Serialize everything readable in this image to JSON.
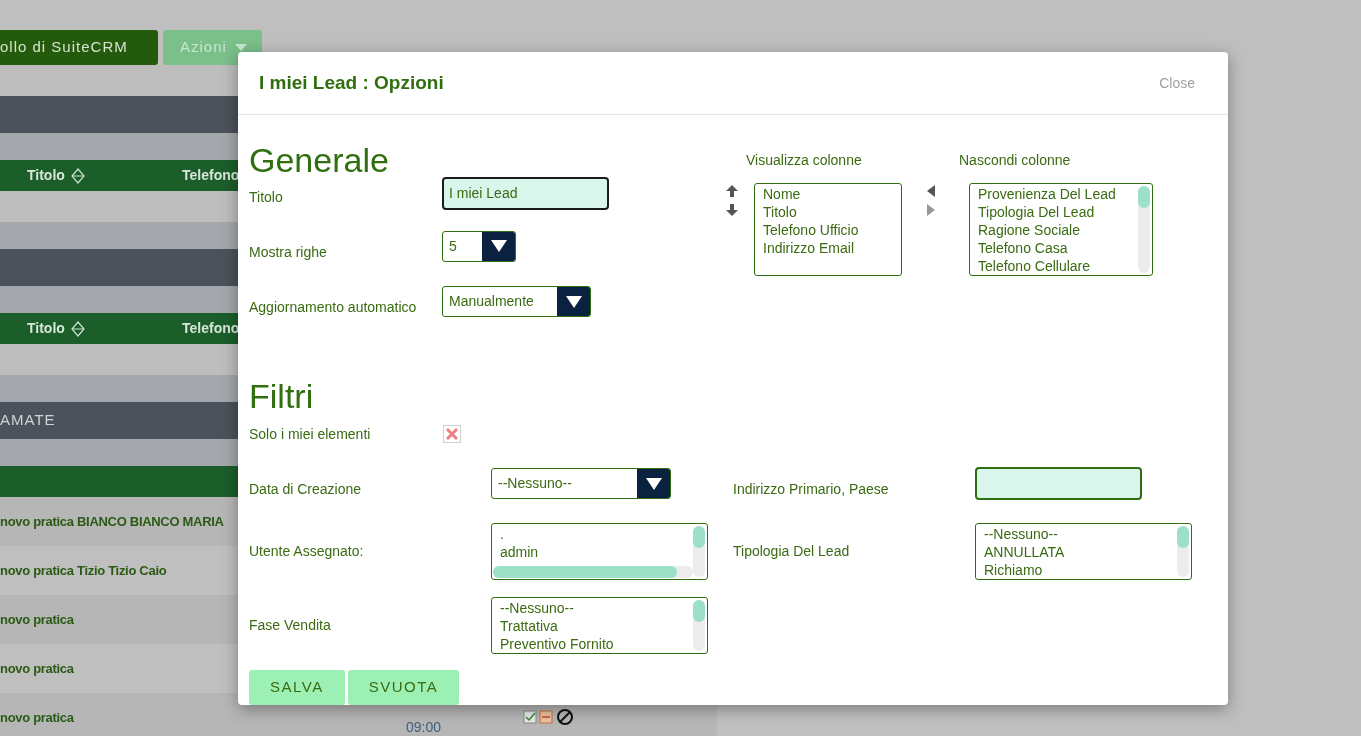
{
  "background": {
    "module_button": "ollo di SuiteCRM",
    "actions_button": "Azioni",
    "rows": [
      {
        "kind": "blank"
      },
      {
        "kind": "band",
        "text": ""
      },
      {
        "kind": "sub"
      },
      {
        "kind": "header",
        "columns": [
          "Titolo",
          "Telefono"
        ]
      },
      {
        "kind": "blank"
      },
      {
        "kind": "sub"
      },
      {
        "kind": "band",
        "text": ""
      },
      {
        "kind": "sub"
      },
      {
        "kind": "header",
        "columns": [
          "Titolo",
          "Telefono"
        ]
      },
      {
        "kind": "blank"
      },
      {
        "kind": "sub"
      },
      {
        "kind": "band",
        "text": "AMATE"
      },
      {
        "kind": "sub"
      },
      {
        "kind": "header",
        "columns": []
      },
      {
        "kind": "row",
        "text": "novo pratica BIANCO BIANCO MARIA"
      },
      {
        "kind": "row",
        "text": "novo pratica Tizio Tizio Caio"
      },
      {
        "kind": "row",
        "text": "novo pratica"
      },
      {
        "kind": "row",
        "text": "novo pratica"
      },
      {
        "kind": "row",
        "text": "novo pratica",
        "time": "09:00"
      }
    ]
  },
  "dialog": {
    "title": "I miei Lead : Opzioni",
    "close": "Close"
  },
  "general": {
    "heading": "Generale",
    "fields": [
      {
        "kind": "text",
        "label": "Titolo",
        "value": "I miei Lead",
        "focused": true
      },
      {
        "kind": "select",
        "label": "Mostra righe",
        "value": "5"
      },
      {
        "kind": "select",
        "label": "Aggiornamento automatico",
        "value": "Manualmente"
      }
    ]
  },
  "columns": {
    "shown": {
      "label": "Visualizza colonne",
      "items": [
        "Nome",
        "Titolo",
        "Telefono Ufficio",
        "Indirizzo Email"
      ]
    },
    "hidden": {
      "label": "Nascondi colonne",
      "items": [
        "Provenienza Del Lead",
        "Tipologia Del Lead",
        "Ragione Sociale",
        "Telefono Casa",
        "Telefono Cellulare"
      ]
    }
  },
  "filters": {
    "heading": "Filtri",
    "rows": [
      [
        {
          "kind": "checkbox",
          "label": "Solo i miei elementi",
          "checked": true
        }
      ],
      [
        {
          "kind": "select",
          "label": "Data di Creazione",
          "value": "--Nessuno--"
        },
        {
          "kind": "text",
          "label": "Indirizzo Primario, Paese"
        }
      ],
      [
        {
          "kind": "listbox",
          "label": "Utente Assegnato:",
          "items": [
            ".",
            "admin"
          ],
          "hscroll": true
        },
        {
          "kind": "listbox",
          "label": "Tipologia Del Lead",
          "items": [
            "--Nessuno--",
            "ANNULLATA",
            "Richiamo"
          ]
        }
      ],
      [
        {
          "kind": "listbox",
          "label": "Fase Vendita",
          "items": [
            "--Nessuno--",
            "Trattativa",
            "Preventivo Fornito"
          ]
        }
      ]
    ]
  },
  "buttons": [
    "SALVA",
    "SVUOTA"
  ]
}
